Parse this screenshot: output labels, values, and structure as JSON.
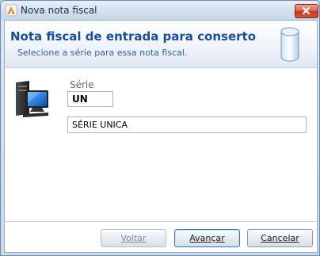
{
  "window": {
    "title": "Nova nota fiscal"
  },
  "header": {
    "title": "Nota fiscal de entrada para conserto",
    "subtitle": "Selecione a série para essa nota fiscal."
  },
  "form": {
    "serie_label": "Série",
    "serie_code": "UN",
    "serie_description": "SÉRIE UNICA"
  },
  "buttons": {
    "back": "Voltar",
    "next": "Avançar",
    "cancel": "Cancelar"
  },
  "icons": {
    "app": "app-icon",
    "close": "close-icon",
    "database": "database-icon",
    "computer": "computer-icon"
  },
  "colors": {
    "title_accent": "#1a4e9c",
    "close_button": "#d8543a"
  }
}
